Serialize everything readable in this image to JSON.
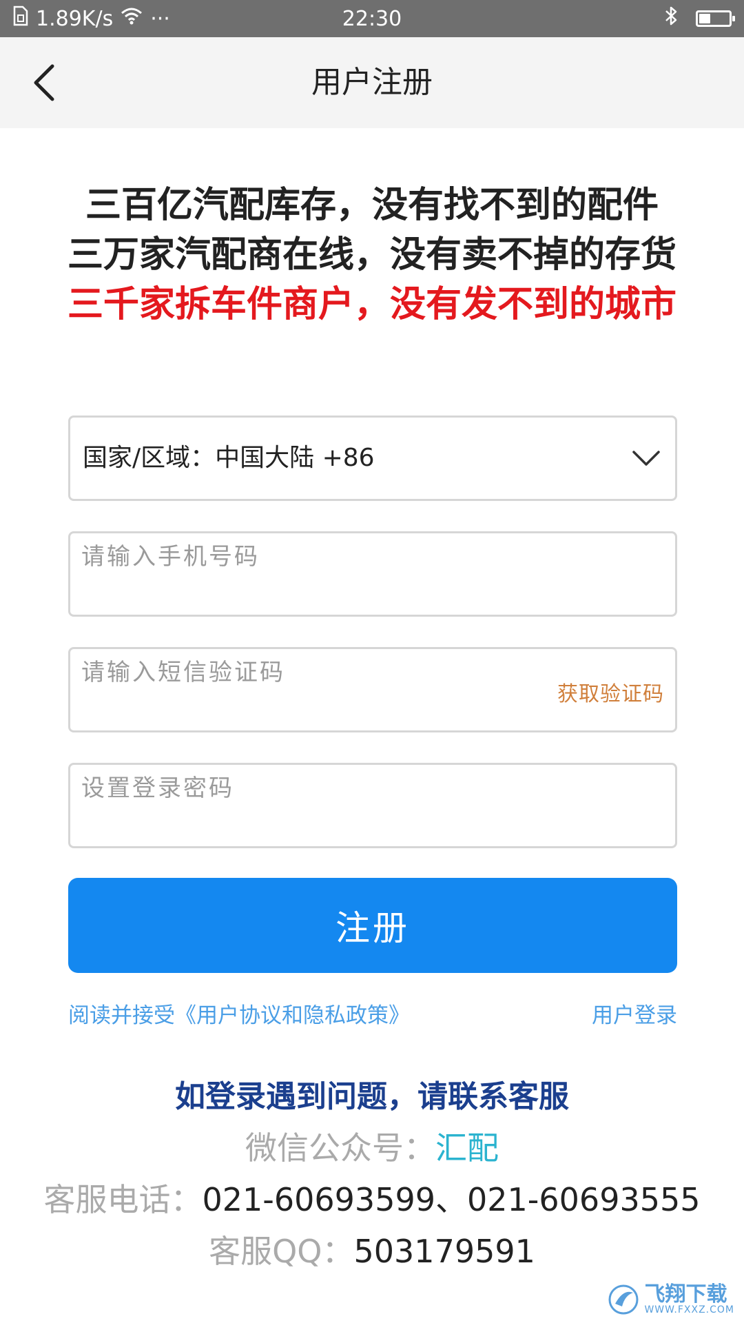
{
  "status_bar": {
    "net_speed": "1.89K/s",
    "dots": "···",
    "time": "22:30",
    "battery_level": 0.35
  },
  "nav": {
    "title": "用户注册"
  },
  "slogans": [
    "三百亿汽配库存，没有找不到的配件",
    "三万家汽配商在线，没有卖不掉的存货",
    "三千家拆车件商户，没有发不到的城市"
  ],
  "form": {
    "country_label": "国家/区域：中国大陆 +86",
    "phone_placeholder": "请输入手机号码",
    "sms_placeholder": "请输入短信验证码",
    "get_code_label": "获取验证码",
    "password_placeholder": "设置登录密码",
    "register_label": "注册",
    "agreement_label": "阅读并接受《用户协议和隐私政策》",
    "login_label": "用户登录"
  },
  "support": {
    "heading": "如登录遇到问题，请联系客服",
    "wechat_label": "微信公众号：",
    "wechat_value": "汇配",
    "phone_label": "客服电话：",
    "phone_value": "021-60693599、021-60693555",
    "qq_label": "客服QQ：",
    "qq_value": "503179591"
  },
  "watermark": {
    "title": "飞翔下载",
    "url": "WWW.FXXZ.COM"
  },
  "colors": {
    "primary": "#1488f0",
    "link": "#4a9ee6",
    "slogan_red": "#e4191e",
    "get_code": "#d07f3b",
    "support_heading": "#1b3f8e",
    "wechat_value": "#2bb3cf"
  },
  "icons": {
    "sim": "sim-card-icon",
    "wifi": "wifi-icon",
    "bluetooth": "bluetooth-icon",
    "battery": "battery-icon",
    "back": "chevron-left-icon",
    "dropdown": "chevron-down-icon"
  }
}
